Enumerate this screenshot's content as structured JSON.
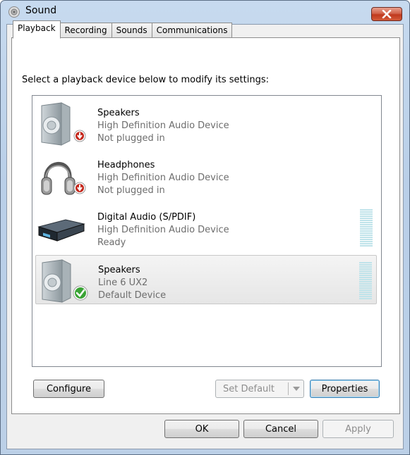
{
  "window": {
    "title": "Sound",
    "accent_close": "#c7432a"
  },
  "tabs": [
    {
      "label": "Playback",
      "active": true
    },
    {
      "label": "Recording",
      "active": false
    },
    {
      "label": "Sounds",
      "active": false
    },
    {
      "label": "Communications",
      "active": false
    }
  ],
  "instruction": "Select a playback device below to modify its settings:",
  "devices": [
    {
      "name": "Speakers",
      "driver": "High Definition Audio Device",
      "status": "Not plugged in",
      "icon": "speaker-icon",
      "badge": "unplugged-badge-icon",
      "selected": false,
      "meter": false
    },
    {
      "name": "Headphones",
      "driver": "High Definition Audio Device",
      "status": "Not plugged in",
      "icon": "headphones-icon",
      "badge": "unplugged-badge-icon",
      "selected": false,
      "meter": false
    },
    {
      "name": "Digital Audio (S/PDIF)",
      "driver": "High Definition Audio Device",
      "status": "Ready",
      "icon": "digital-receiver-icon",
      "badge": null,
      "selected": false,
      "meter": true
    },
    {
      "name": "Speakers",
      "driver": "Line 6 UX2",
      "status": "Default Device",
      "icon": "speaker-icon",
      "badge": "default-check-badge-icon",
      "selected": true,
      "meter": true
    }
  ],
  "buttons": {
    "configure": "Configure",
    "set_default": "Set Default",
    "properties": "Properties",
    "ok": "OK",
    "cancel": "Cancel",
    "apply": "Apply"
  }
}
